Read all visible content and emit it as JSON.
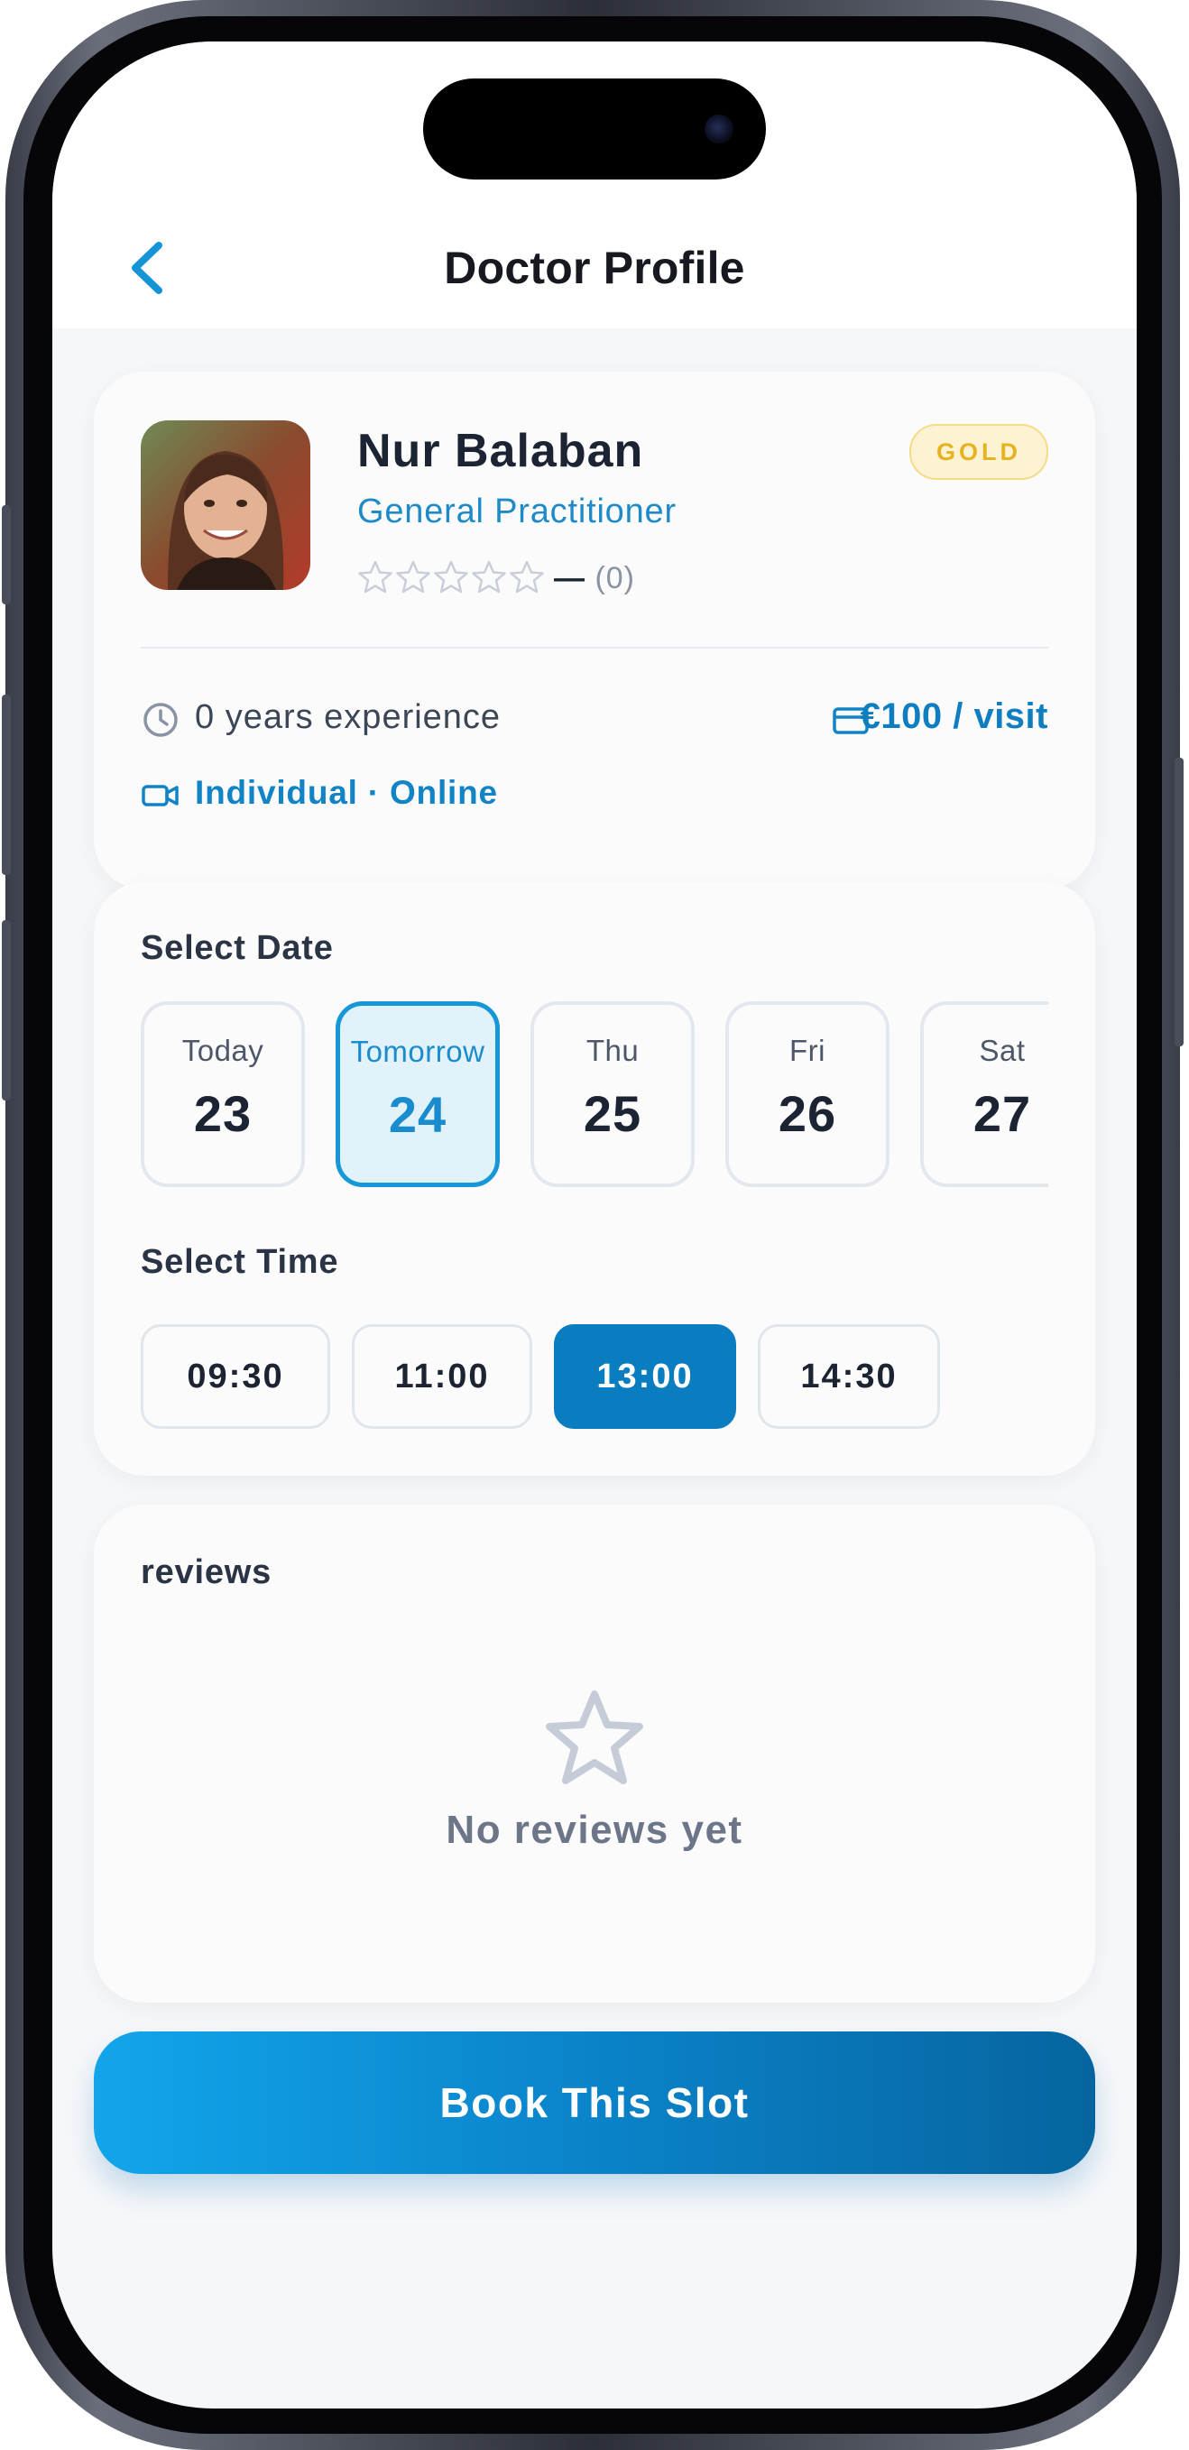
{
  "header": {
    "title": "Doctor Profile",
    "back_icon": "chevron-left-icon"
  },
  "profile": {
    "name": "Nur Balaban",
    "specialty": "General Practitioner",
    "badge": "GOLD",
    "rating": {
      "stars_filled": 0,
      "stars_total": 5,
      "value": "—",
      "count": "(0)"
    },
    "experience": "0 years experience",
    "price": "€100 / visit",
    "mode": "Individual · Online",
    "accent_color": "#0f7ec0"
  },
  "schedule": {
    "date_title": "Select Date",
    "dates": [
      {
        "day": "Today",
        "num": "23"
      },
      {
        "day": "Tomorrow",
        "num": "24",
        "selected": true
      },
      {
        "day": "Thu",
        "num": "25"
      },
      {
        "day": "Fri",
        "num": "26"
      },
      {
        "day": "Sat",
        "num": "27"
      }
    ],
    "time_title": "Select Time",
    "times": [
      {
        "label": "09:30"
      },
      {
        "label": "11:00"
      },
      {
        "label": "13:00",
        "selected": true
      },
      {
        "label": "14:30"
      }
    ]
  },
  "reviews": {
    "title": "reviews",
    "empty_icon": "star-outline-icon",
    "empty_text": "No reviews yet"
  },
  "book_button": {
    "label": "Book This Slot"
  }
}
